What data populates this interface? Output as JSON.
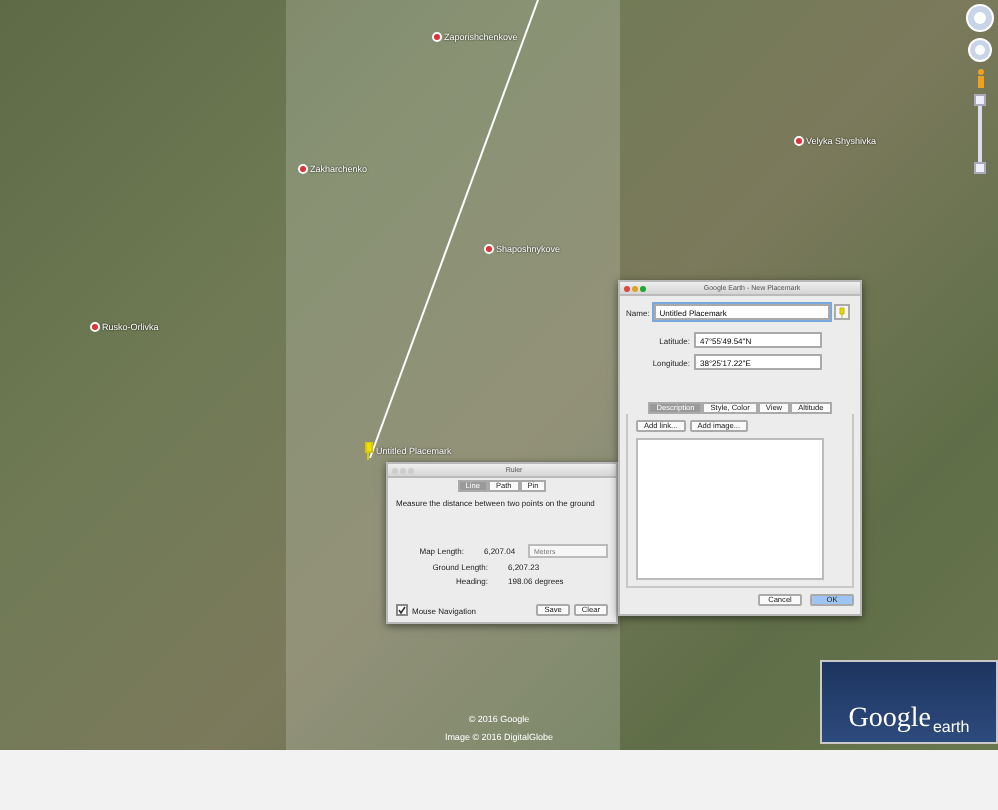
{
  "map": {
    "places": [
      {
        "name": "Zaporishchenkove"
      },
      {
        "name": "Zakharchenko"
      },
      {
        "name": "Shaposhnykove"
      },
      {
        "name": "Velyka Shyshivka"
      },
      {
        "name": "Rusko-Orlivka"
      }
    ],
    "placemark": "Untitled Placemark",
    "copyright": "© 2016 Google",
    "imagery": "Image © 2016 DigitalGlobe"
  },
  "placemark_dialog": {
    "title": "Google Earth - New Placemark",
    "name_label": "Name:",
    "name_value": "Untitled Placemark",
    "latitude_label": "Latitude:",
    "latitude": "47°55'49.54\"N",
    "longitude_label": "Longitude:",
    "longitude": "38°25'17.22\"E",
    "tabs": [
      {
        "label": "Description",
        "selected": true
      },
      {
        "label": "Style, Color",
        "selected": false
      },
      {
        "label": "View",
        "selected": false
      },
      {
        "label": "Altitude",
        "selected": false
      }
    ],
    "add_buttons": [
      "Add link...",
      "Add image..."
    ],
    "buttons": [
      {
        "label": "Cancel",
        "default": false
      },
      {
        "label": "OK",
        "default": true
      }
    ]
  },
  "ruler_dialog": {
    "title": "Ruler",
    "tabs": [
      {
        "label": "Line",
        "selected": true
      },
      {
        "label": "Path",
        "selected": false
      },
      {
        "label": "Pin",
        "selected": false
      }
    ],
    "instruction": "Measure the distance between two points on the ground",
    "rows": [
      {
        "label": "Map Length:",
        "value": "6,207.04"
      },
      {
        "label": "Ground Length:",
        "value": "6,207.23"
      },
      {
        "label": "Heading:",
        "value": "198.06 degrees"
      }
    ],
    "unit": "Meters",
    "mouse_navigation": {
      "label": "Mouse Navigation",
      "checked": true
    },
    "buttons": [
      "Save",
      "Clear"
    ]
  },
  "logo": {
    "word": "Google",
    "product": "earth"
  }
}
